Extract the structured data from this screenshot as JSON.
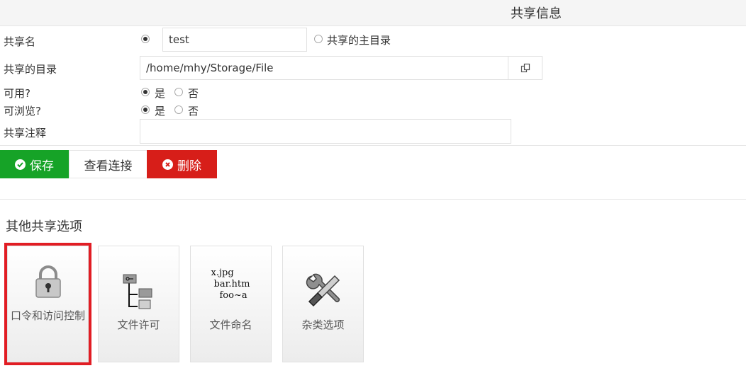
{
  "header": {
    "title": "共享信息"
  },
  "form": {
    "share_name_label": "共享名",
    "share_name_value": "test",
    "home_dir_option": "共享的主目录",
    "directory_label": "共享的目录",
    "directory_value": "/home/mhy/Storage/File",
    "available_label": "可用?",
    "browseable_label": "可浏览?",
    "yes_label": "是",
    "no_label": "否",
    "comment_label": "共享注释",
    "comment_value": ""
  },
  "actions": {
    "save_label": "保存",
    "view_connections_label": "查看连接",
    "delete_label": "删除"
  },
  "other_options": {
    "title": "其他共享选项",
    "cards": [
      {
        "label": "口令和访问控制",
        "icon": "lock-icon",
        "selected": true
      },
      {
        "label": "文件许可",
        "icon": "file-permissions-icon",
        "selected": false
      },
      {
        "label": "文件命名",
        "icon": "file-naming-icon",
        "selected": false,
        "icon_text": [
          "x.jpg",
          "bar.htm",
          "foo~a"
        ]
      },
      {
        "label": "杂类选项",
        "icon": "tools-icon",
        "selected": false
      }
    ]
  },
  "colors": {
    "save": "#16a327",
    "delete": "#d71e19",
    "selected_outline": "#e11d24"
  }
}
